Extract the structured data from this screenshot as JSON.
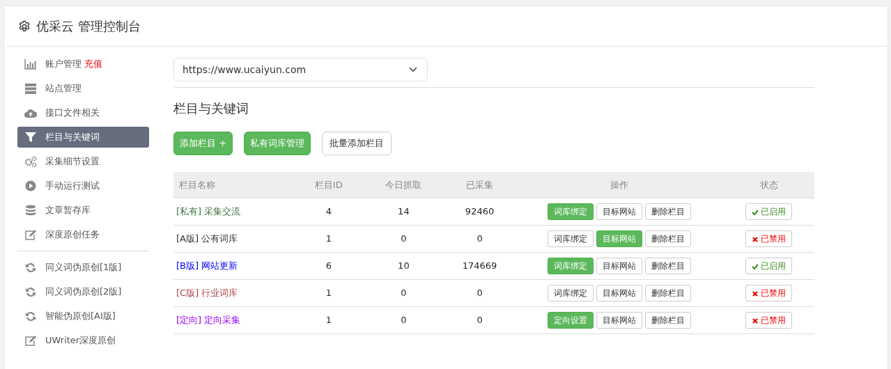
{
  "header": {
    "title": "优采云 管理控制台"
  },
  "sidebar": {
    "items": [
      {
        "kind": "item",
        "label": "账户管理",
        "extra": "充值",
        "selected": false
      },
      {
        "kind": "item",
        "label": "站点管理",
        "selected": false
      },
      {
        "kind": "item",
        "label": "接口文件相关",
        "selected": false
      },
      {
        "kind": "item",
        "label": "栏目与关键词",
        "selected": true
      },
      {
        "kind": "item",
        "label": "采集细节设置",
        "selected": false
      },
      {
        "kind": "item",
        "label": "手动运行测试",
        "selected": false
      },
      {
        "kind": "item",
        "label": "文章暂存库",
        "selected": false
      },
      {
        "kind": "item",
        "label": "深度原创任务",
        "selected": false
      },
      {
        "kind": "divider"
      },
      {
        "kind": "item",
        "label": "同义词伪原创[1版]",
        "selected": false
      },
      {
        "kind": "item",
        "label": "同义词伪原创[2版]",
        "selected": false
      },
      {
        "kind": "item",
        "label": "智能伪原创[AI版]",
        "selected": false
      },
      {
        "kind": "item",
        "label": "UWriter深度原创",
        "selected": false
      }
    ]
  },
  "site_select": {
    "value": "https://www.ucaiyun.com"
  },
  "section_title": "栏目与关键词",
  "toolbar": [
    {
      "label": "添加栏目 +",
      "kind": "primary"
    },
    {
      "label": "私有词库管理",
      "kind": "primary"
    },
    {
      "label": "批量添加栏目",
      "kind": "outline"
    }
  ],
  "table": {
    "columns": [
      "栏目名称",
      "栏目ID",
      "今日抓取",
      "已采集",
      "操作",
      "状态"
    ],
    "rows": [
      {
        "tag": "[私有]",
        "name": "采集交流",
        "color": "#3c763d",
        "id": "4",
        "today": "14",
        "collected": "92460",
        "actions": [
          {
            "label": "词库绑定",
            "kind": "primary"
          },
          {
            "label": "目标网站",
            "kind": "outline"
          },
          {
            "label": "删除栏目",
            "kind": "outline"
          }
        ],
        "status": "已启用",
        "enabled": true
      },
      {
        "tag": "[A版]",
        "name": "公有词库",
        "color": "#333333",
        "id": "1",
        "today": "0",
        "collected": "0",
        "actions": [
          {
            "label": "词库绑定",
            "kind": "outline"
          },
          {
            "label": "目标网站",
            "kind": "primary"
          },
          {
            "label": "删除栏目",
            "kind": "outline"
          }
        ],
        "status": "已禁用",
        "enabled": false
      },
      {
        "tag": "[B版]",
        "name": "网站更新",
        "color": "#0000ff",
        "id": "6",
        "today": "10",
        "collected": "174669",
        "actions": [
          {
            "label": "词库绑定",
            "kind": "primary"
          },
          {
            "label": "目标网站",
            "kind": "outline"
          },
          {
            "label": "删除栏目",
            "kind": "outline"
          }
        ],
        "status": "已启用",
        "enabled": true
      },
      {
        "tag": "[C版]",
        "name": "行业词库",
        "color": "#a94442",
        "id": "1",
        "today": "0",
        "collected": "0",
        "actions": [
          {
            "label": "词库绑定",
            "kind": "outline"
          },
          {
            "label": "目标网站",
            "kind": "outline"
          },
          {
            "label": "删除栏目",
            "kind": "outline"
          }
        ],
        "status": "已禁用",
        "enabled": false
      },
      {
        "tag": "[定向]",
        "name": "定向采集",
        "color": "#9900ff",
        "id": "1",
        "today": "0",
        "collected": "0",
        "actions": [
          {
            "label": "定向设置",
            "kind": "primary"
          },
          {
            "label": "目标网站",
            "kind": "outline"
          },
          {
            "label": "删除栏目",
            "kind": "outline"
          }
        ],
        "status": "已禁用",
        "enabled": false
      }
    ]
  }
}
